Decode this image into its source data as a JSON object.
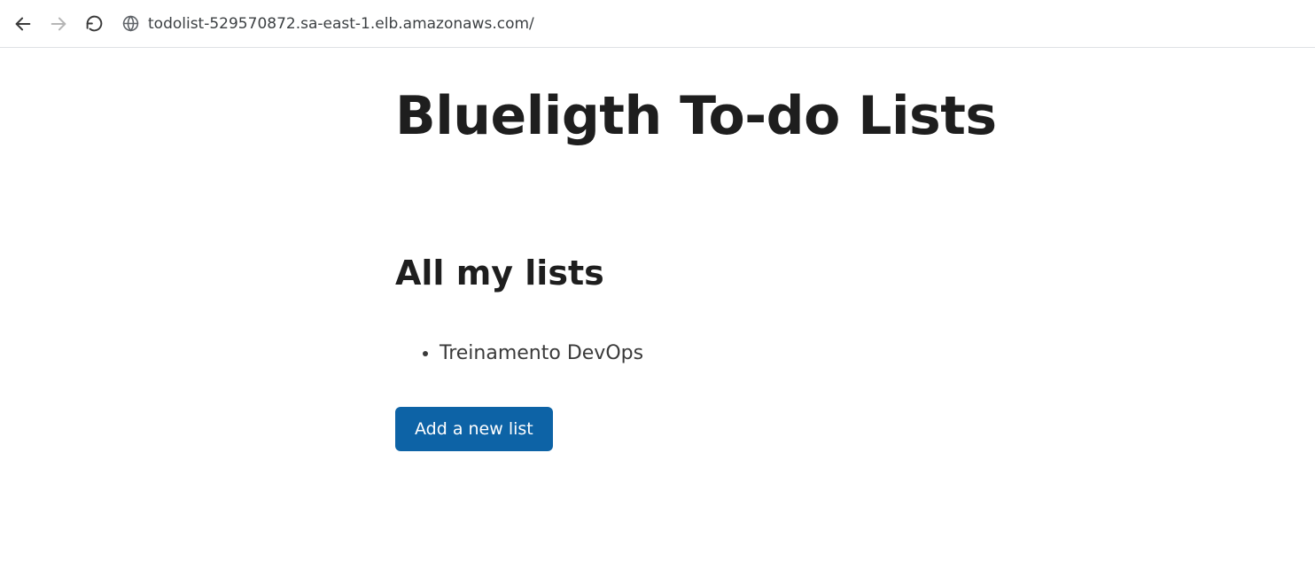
{
  "browser": {
    "url": "todolist-529570872.sa-east-1.elb.amazonaws.com/"
  },
  "page": {
    "title": "Blueligth To-do Lists",
    "section_title": "All my lists",
    "lists": [
      {
        "name": "Treinamento DevOps"
      }
    ],
    "add_button_label": "Add a new list"
  }
}
